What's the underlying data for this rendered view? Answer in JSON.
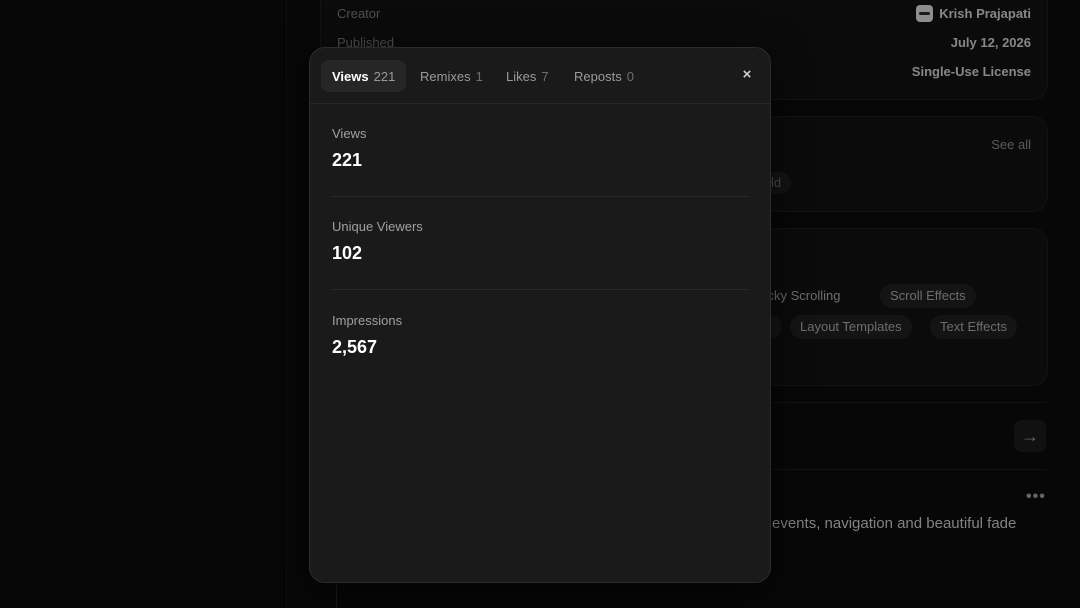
{
  "background": {
    "details": [
      {
        "key": "Creator",
        "value": "Krish Prajapati"
      },
      {
        "key": "Published",
        "value": "July 12, 2026"
      },
      {
        "key": "",
        "value": "Single-Use License"
      }
    ],
    "similar": {
      "see_all": "See all",
      "partial_chip": "ld"
    },
    "tags": [
      "ticky Scrolling",
      "Scroll Effects",
      "Layout Templates",
      "Text Effects"
    ],
    "description": "events, navigation and beautiful fade"
  },
  "modal": {
    "tabs": [
      {
        "label": "Views",
        "count": "221"
      },
      {
        "label": "Remixes",
        "count": "1"
      },
      {
        "label": "Likes",
        "count": "7"
      },
      {
        "label": "Reposts",
        "count": "0"
      }
    ],
    "close": "×",
    "stats": [
      {
        "label": "Views",
        "value": "221"
      },
      {
        "label": "Unique Viewers",
        "value": "102"
      },
      {
        "label": "Impressions",
        "value": "2,567"
      }
    ]
  }
}
